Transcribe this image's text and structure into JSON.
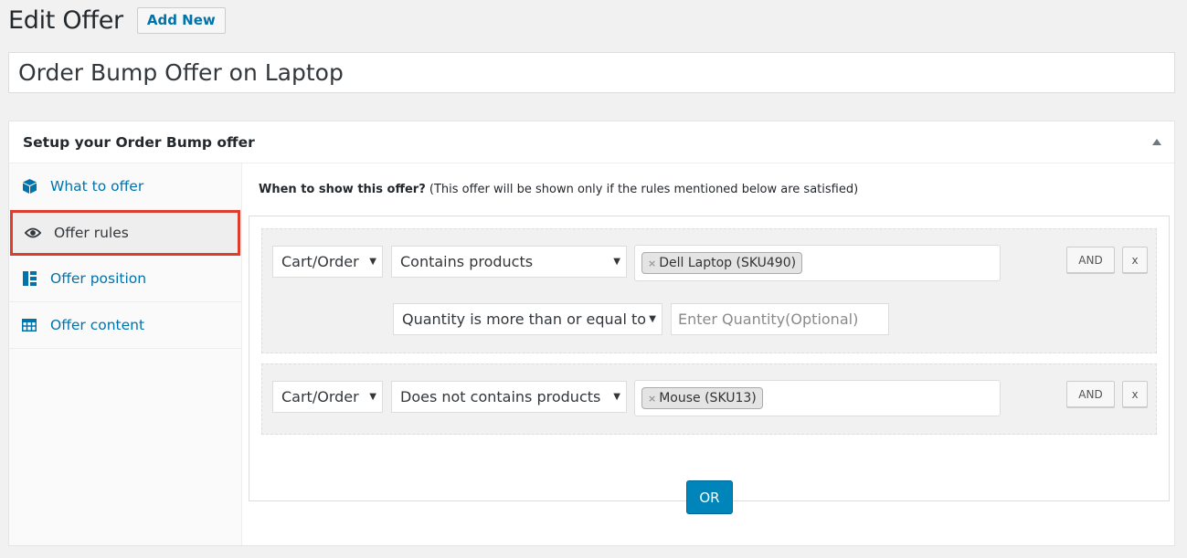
{
  "header": {
    "title": "Edit Offer",
    "add_new": "Add New"
  },
  "offer_title": "Order Bump Offer on Laptop",
  "metabox": {
    "title": "Setup your Order Bump offer",
    "toggle_icon": "triangle-up-icon"
  },
  "tabs": [
    {
      "label": "What to offer",
      "icon": "cube-icon"
    },
    {
      "label": "Offer rules",
      "icon": "eye-icon"
    },
    {
      "label": "Offer position",
      "icon": "layout-icon"
    },
    {
      "label": "Offer content",
      "icon": "table-icon"
    }
  ],
  "rules": {
    "heading_bold": "When to show this offer?",
    "heading_note": " (This offer will be shown only if the rules mentioned below are satisfied)",
    "groups": [
      {
        "scope": "Cart/Order",
        "condition": "Contains products",
        "product": "Dell Laptop (SKU490)",
        "quantity_condition": "Quantity is more than or equal to",
        "quantity_placeholder": "Enter Quantity(Optional)",
        "and_label": "AND",
        "remove_label": "x"
      },
      {
        "scope": "Cart/Order",
        "condition": "Does not contains products",
        "product": "Mouse (SKU13)",
        "and_label": "AND",
        "remove_label": "x"
      }
    ],
    "or_label": "OR"
  },
  "colors": {
    "link": "#0073aa",
    "primary": "#0085ba",
    "highlight": "#dd3d2c"
  }
}
